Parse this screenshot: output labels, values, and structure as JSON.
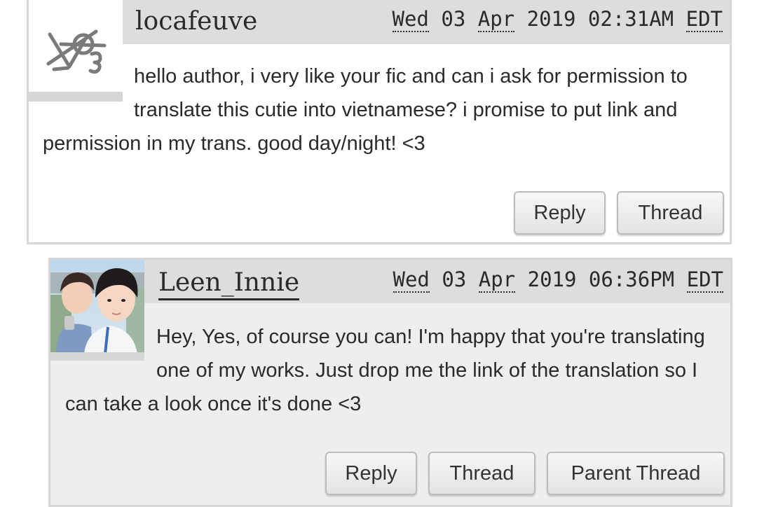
{
  "comments": [
    {
      "username": "locafeuve",
      "timestamp": {
        "day": "Wed",
        "date": "03",
        "month": "Apr",
        "year": "2019",
        "time": "02:31AM",
        "tz": "EDT"
      },
      "body": "hello author, i very like your fic and can i ask for permission to translate this cutie into vietnamese? i promise to put link and permission in my trans. good day/night! <3",
      "avatar": "default-avatar-icon",
      "actions": {
        "reply": "Reply",
        "thread": "Thread"
      }
    },
    {
      "username": "Leen_Innie",
      "timestamp": {
        "day": "Wed",
        "date": "03",
        "month": "Apr",
        "year": "2019",
        "time": "06:36PM",
        "tz": "EDT"
      },
      "body": "Hey, Yes, of course you can! I'm happy that you're translating one of my works. Just drop me the link of the translation so I can take a look once it's done <3",
      "avatar": "user-photo-avatar",
      "actions": {
        "reply": "Reply",
        "thread": "Thread",
        "parent_thread": "Parent Thread"
      }
    }
  ],
  "colors": {
    "header_band": "#dddddd",
    "reply_background": "#eeeeee",
    "border": "#d6d6d6",
    "text": "#2a2a2a"
  }
}
